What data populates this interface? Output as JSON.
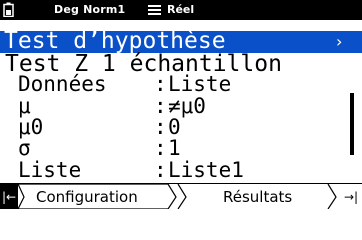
{
  "statusbar": {
    "mode": "Deg Norm1",
    "format_icon": "fraction-format-icon",
    "complex_mode": "Réel",
    "battery_icon": "battery-icon"
  },
  "menu": {
    "title": "Test d’hypothèse",
    "title_arrow": "›",
    "subtitle": "Test Z 1 échantillon"
  },
  "rows": [
    {
      "label": "Données",
      "value": "Liste"
    },
    {
      "label": "μ",
      "value": "≠μ0"
    },
    {
      "label": "μ0",
      "value": "0"
    },
    {
      "label": "σ",
      "value": "1"
    },
    {
      "label": "Liste",
      "value": "Liste1"
    }
  ],
  "colon": ":",
  "tabs": {
    "nav_left": "|←",
    "configuration": "Configuration",
    "resultats": "Résultats",
    "nav_right": "→|"
  },
  "colors": {
    "selection": "#0a50c8",
    "statusbar": "#000000",
    "text": "#000000"
  }
}
